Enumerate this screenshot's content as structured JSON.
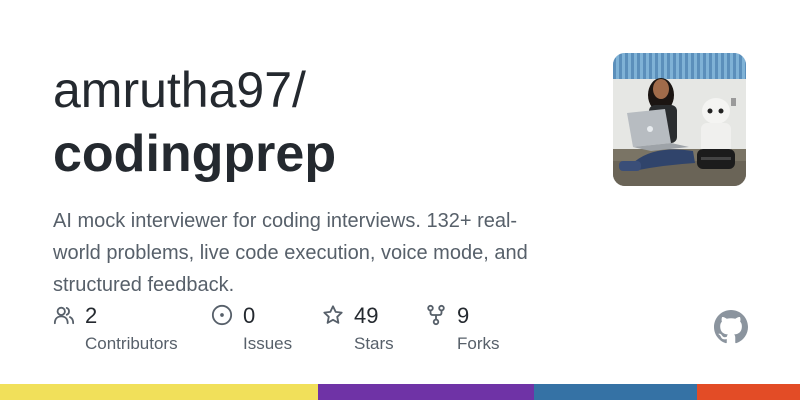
{
  "repo": {
    "owner_prefix": "amrutha97/",
    "name": "codingprep",
    "description": "AI mock interviewer for coding interviews. 132+ real-world problems, live code execution, voice mode, and structured feedback."
  },
  "stats": [
    {
      "icon": "people-icon",
      "value": "2",
      "label": "Contributors"
    },
    {
      "icon": "issue-circle-icon",
      "value": "0",
      "label": "Issues"
    },
    {
      "icon": "star-icon",
      "value": "49",
      "label": "Stars"
    },
    {
      "icon": "fork-icon",
      "value": "9",
      "label": "Forks"
    }
  ],
  "colors": {
    "text_primary": "#24292f",
    "text_secondary": "#57606a",
    "icon": "#57606a",
    "language_bar": [
      "#f1e05a",
      "#6f33a6",
      "#3572a5",
      "#e34c26"
    ]
  },
  "icons": {
    "brand": "github-logo-icon",
    "avatar": "user-avatar"
  }
}
